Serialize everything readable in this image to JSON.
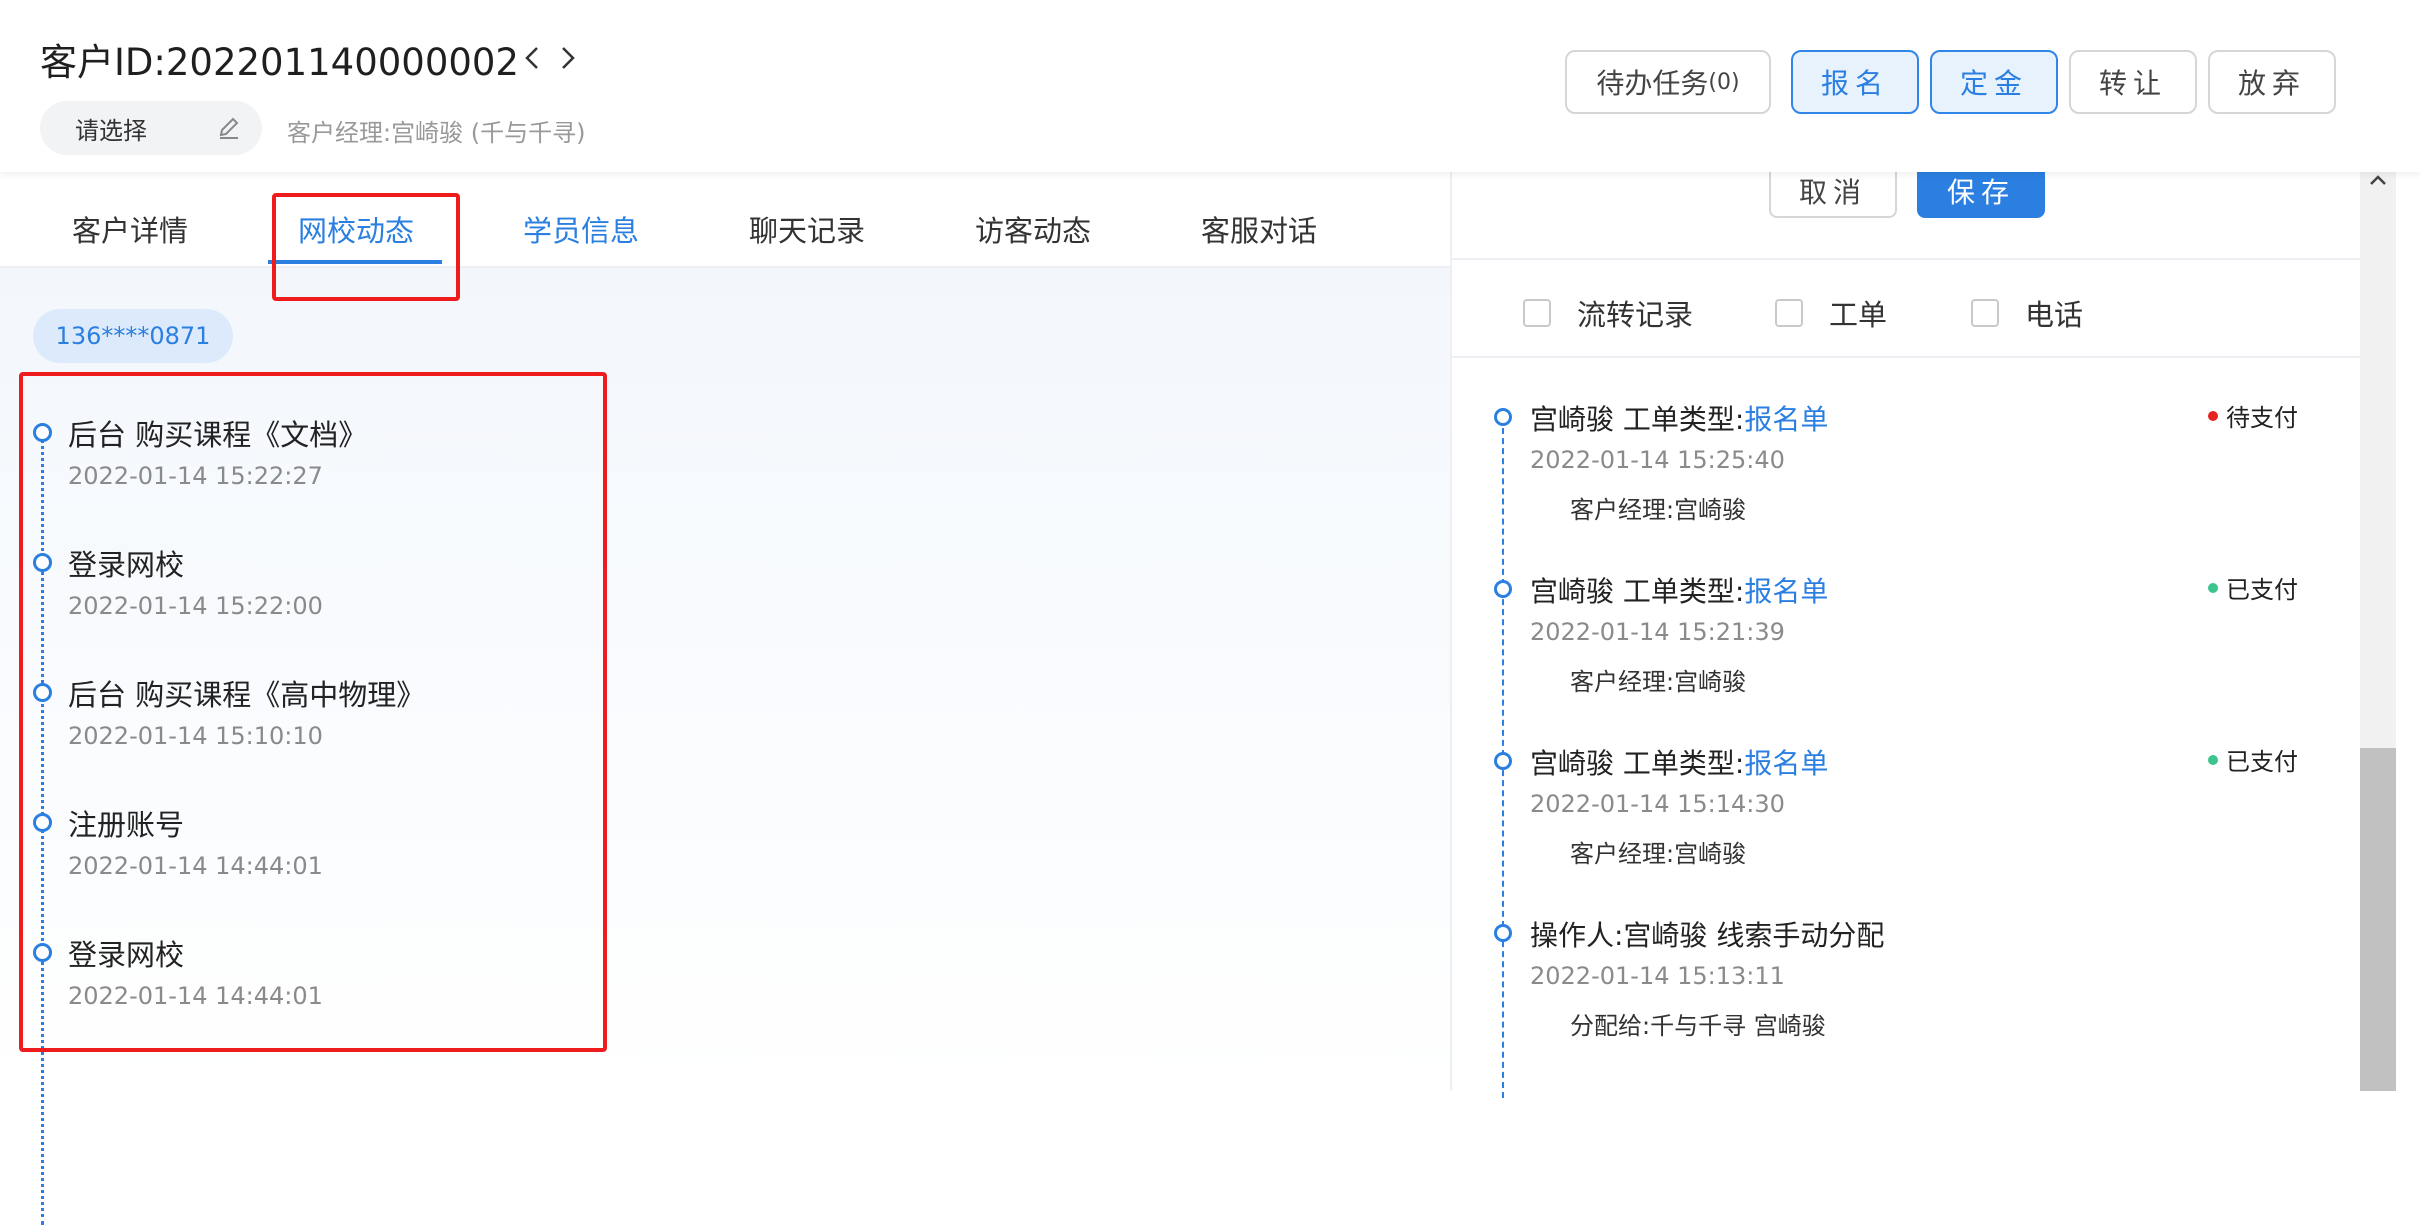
{
  "header": {
    "customer_id": "客户ID:202201140000002",
    "select_placeholder": "请选择",
    "manager": "客户经理:宫崎骏 (千与千寻)",
    "buttons": {
      "todo": "待办任务",
      "todo_count": "(0)",
      "signup": "报名",
      "deposit": "定金",
      "transfer": "转让",
      "abandon": "放弃"
    }
  },
  "tabs": [
    "客户详情",
    "网校动态",
    "学员信息",
    "聊天记录",
    "访客动态",
    "客服对话"
  ],
  "active_tab": "网校动态",
  "phone_tag": "136****0871",
  "school_activity": [
    {
      "title": "后台 购买课程《文档》",
      "time": "2022-01-14 15:22:27"
    },
    {
      "title": "登录网校",
      "time": "2022-01-14 15:22:00"
    },
    {
      "title": "后台 购买课程《高中物理》",
      "time": "2022-01-14 15:10:10"
    },
    {
      "title": "注册账号",
      "time": "2022-01-14 14:44:01"
    },
    {
      "title": "登录网校",
      "time": "2022-01-14 14:44:01"
    }
  ],
  "right_panel": {
    "cancel_label": "取消",
    "save_label": "保存",
    "filters": [
      "流转记录",
      "工单",
      "电话"
    ],
    "records": [
      {
        "prefix": "宫崎骏 工单类型:",
        "link": "报名单",
        "time": "2022-01-14 15:25:40",
        "sub": "客户经理:宫崎骏",
        "status": "待支付",
        "status_color": "#e62222"
      },
      {
        "prefix": "宫崎骏 工单类型:",
        "link": "报名单",
        "time": "2022-01-14 15:21:39",
        "sub": "客户经理:宫崎骏",
        "status": "已支付",
        "status_color": "#3cc48f"
      },
      {
        "prefix": "宫崎骏 工单类型:",
        "link": "报名单",
        "time": "2022-01-14 15:14:30",
        "sub": "客户经理:宫崎骏",
        "status": "已支付",
        "status_color": "#3cc48f"
      },
      {
        "prefix": "操作人:宫崎骏 线索手动分配",
        "link": "",
        "time": "2022-01-14 15:13:11",
        "sub": "分配给:千与千寻 宫崎骏",
        "status": "",
        "status_color": ""
      }
    ]
  },
  "colors": {
    "accent": "#2a7fe0",
    "highlight": "#ee1c1c"
  }
}
